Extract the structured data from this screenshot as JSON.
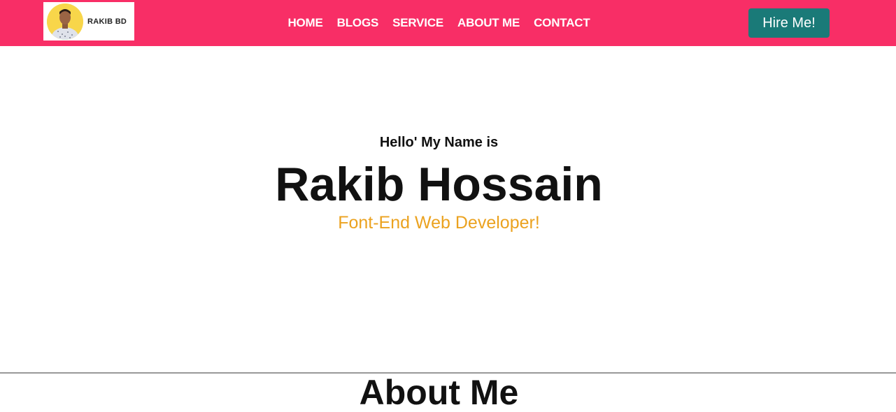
{
  "header": {
    "logo": {
      "text": "RAKIB BD",
      "avatar": "profile-photo"
    },
    "nav": [
      {
        "label": "HOME"
      },
      {
        "label": "BLOGS"
      },
      {
        "label": "SERVICE"
      },
      {
        "label": "ABOUT ME"
      },
      {
        "label": "CONTACT"
      }
    ],
    "cta_label": "Hire Me!"
  },
  "hero": {
    "greeting": "Hello' My Name is",
    "name": "Rakib Hossain",
    "role": "Font-End Web Developer!"
  },
  "about": {
    "title": "About Me"
  },
  "colors": {
    "navbar": "#f82e66",
    "button": "#1a7a78",
    "accent": "#eba21f",
    "logo_circle": "#f8d64a"
  }
}
